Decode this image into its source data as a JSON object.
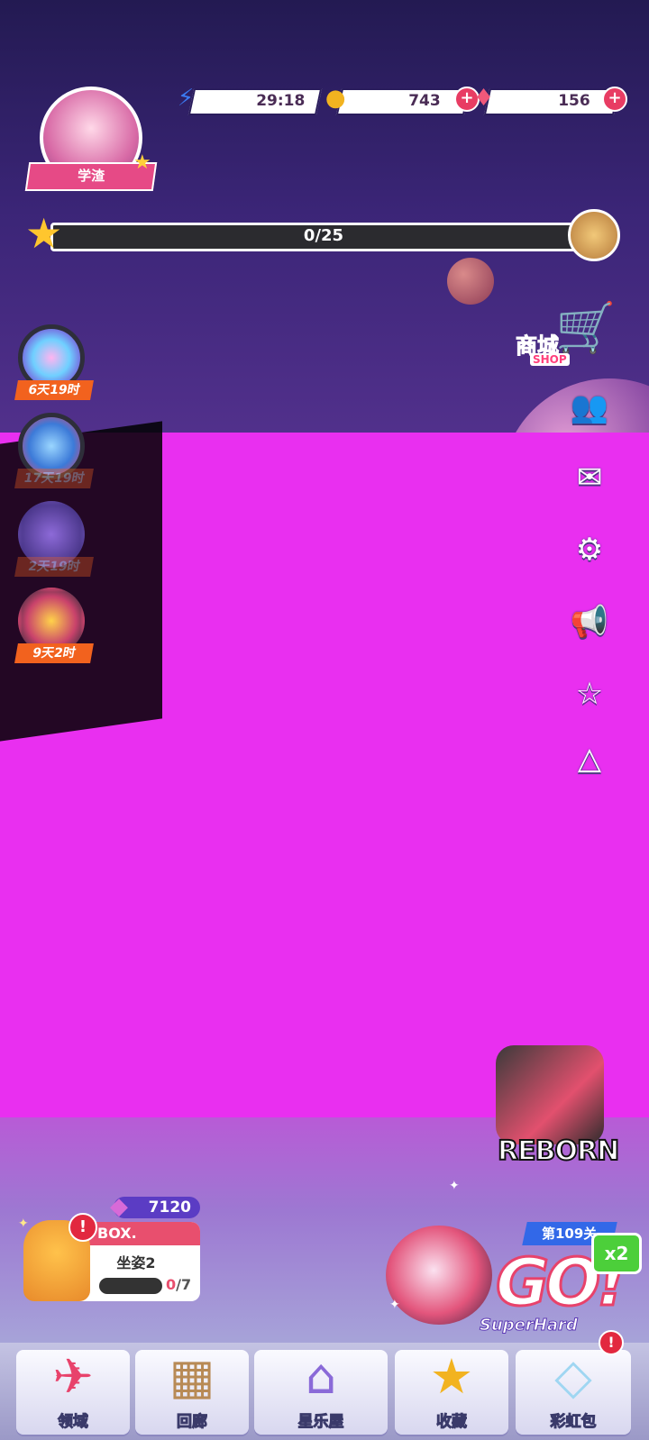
{
  "resources": {
    "energy": {
      "icon": "lightning-icon",
      "value": "29:18"
    },
    "coins": {
      "icon": "coin-icon",
      "value": "743"
    },
    "gems": {
      "icon": "gem-icon",
      "value": "156"
    }
  },
  "player": {
    "name": "学渣"
  },
  "progress": {
    "label": "0/25",
    "current": 0,
    "total": 25
  },
  "shop": {
    "label_cn": "商城",
    "label_en": "SHOP"
  },
  "side_icons": [
    "friends-icon",
    "mail-icon",
    "settings-icon",
    "announcement-icon",
    "favorite-star-icon",
    "collapse-triangle-icon"
  ],
  "activities": [
    {
      "name": "rainbow-orb-event",
      "timer": "6天19时"
    },
    {
      "name": "chest-event",
      "timer": "17天19时"
    },
    {
      "name": "dice-box-event",
      "timer": "2天19时"
    },
    {
      "name": "party-event",
      "timer": "9天2时"
    }
  ],
  "reborn": {
    "label": "REBORN"
  },
  "box_widget": {
    "gems": "7120",
    "title": "BOX.",
    "pose": "坐姿2",
    "count_current": "0",
    "count_total": "/7"
  },
  "go_widget": {
    "level": "第109关",
    "go": "GO!",
    "multiplier": "x2",
    "difficulty": "SuperHard"
  },
  "nav": [
    {
      "label": "领域",
      "icon": "domain-icon"
    },
    {
      "label": "回廊",
      "icon": "gallery-icon"
    },
    {
      "label": "星乐屋",
      "icon": "star-house-icon"
    },
    {
      "label": "收藏",
      "icon": "collection-star-icon"
    },
    {
      "label": "彩虹包",
      "icon": "rainbow-pack-icon"
    }
  ],
  "colors": {
    "magenta": "#e92ff0",
    "sky": "#2a1d5c",
    "accent_red": "#e84f6e",
    "timer_orange": "#f2621e"
  }
}
